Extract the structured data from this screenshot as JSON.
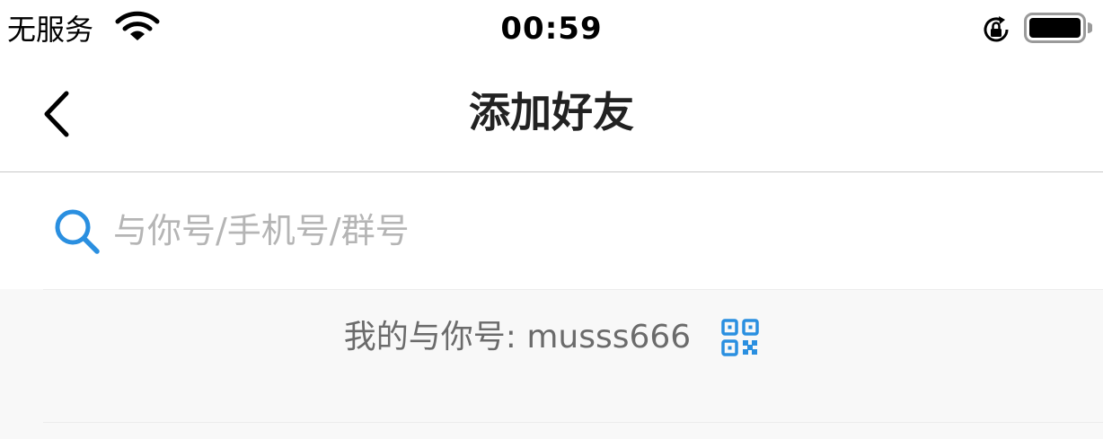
{
  "status_bar": {
    "carrier": "无服务",
    "time": "00:59",
    "icons": [
      "wifi-icon",
      "rotation-lock-icon",
      "battery-icon"
    ]
  },
  "nav": {
    "title": "添加好友",
    "back_icon": "chevron-left-icon"
  },
  "search": {
    "placeholder": "与你号/手机号/群号",
    "value": "",
    "icon": "search-icon"
  },
  "my_id": {
    "label": "我的与你号: musss666",
    "icon": "qr-code-icon"
  },
  "colors": {
    "accent": "#2a8fe0",
    "title_text": "#222222",
    "placeholder": "#b5b5b5",
    "secondary_text": "#6b6b6b",
    "section_bg": "#f8f8f8"
  }
}
